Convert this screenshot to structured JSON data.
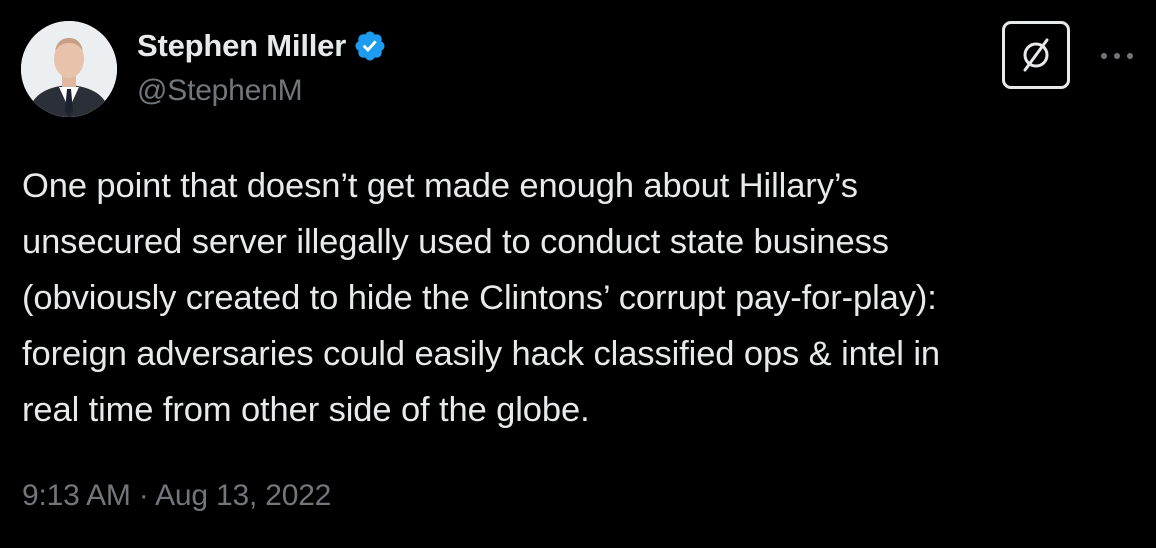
{
  "author": {
    "display_name": "Stephen Miller",
    "handle": "@StephenM",
    "verified": true,
    "avatar_icon": "profile-photo"
  },
  "actions": {
    "grok_icon": "grok-icon",
    "more_icon": "more-horizontal-icon"
  },
  "tweet": {
    "text": "One point that doesn’t get made enough about Hillary’s\nunsecured server illegally used to conduct state business\n(obviously created to hide the Clintons’ corrupt pay-for-play):\nforeign adversaries could easily hack classified ops & intel in\nreal time from other side of the globe.",
    "timestamp": "9:13 AM · Aug 13, 2022"
  },
  "colors": {
    "background": "#000000",
    "primary_text": "#e7e9ea",
    "secondary_text": "#71767b",
    "verified_badge": "#1d9bf0"
  }
}
